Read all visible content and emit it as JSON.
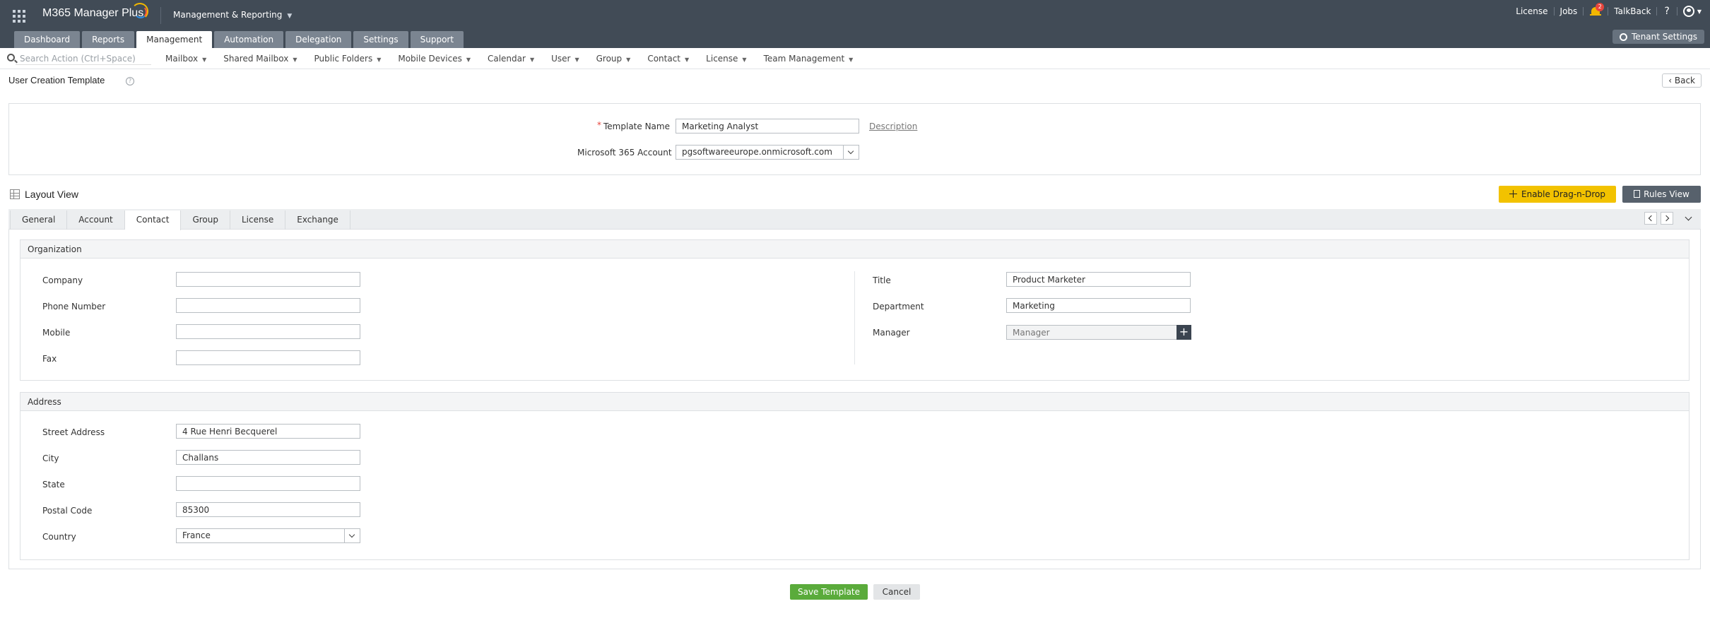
{
  "header": {
    "app_name": "M365 Manager Plus",
    "module": "Management & Reporting",
    "links": [
      "License",
      "Jobs"
    ],
    "notification_count": "2",
    "talkback": "TalkBack",
    "help": "?",
    "tenant_settings": "Tenant Settings"
  },
  "tabs": [
    "Dashboard",
    "Reports",
    "Management",
    "Automation",
    "Delegation",
    "Settings",
    "Support"
  ],
  "active_tab": "Management",
  "subnav": {
    "search_placeholder": "Search Action (Ctrl+Space)",
    "menus": [
      "Mailbox",
      "Shared Mailbox",
      "Public Folders",
      "Mobile Devices",
      "Calendar",
      "User",
      "Group",
      "Contact",
      "License",
      "Team Management"
    ]
  },
  "page": {
    "title": "User Creation Template",
    "back": "Back"
  },
  "template": {
    "name_label": "Template Name",
    "name_value": "Marketing Analyst",
    "description_link": "Description",
    "account_label": "Microsoft 365 Account",
    "account_value": "pgsoftwareeurope.onmicrosoft.com"
  },
  "layout": {
    "title": "Layout View",
    "drag_drop": "Enable Drag-n-Drop",
    "rules_view": "Rules View",
    "tabs": [
      "General",
      "Account",
      "Contact",
      "Group",
      "License",
      "Exchange"
    ],
    "active_tab": "Contact"
  },
  "organization": {
    "title": "Organization",
    "company_label": "Company",
    "company_value": "",
    "phone_label": "Phone Number",
    "phone_value": "",
    "mobile_label": "Mobile",
    "mobile_value": "",
    "fax_label": "Fax",
    "fax_value": "",
    "title_label": "Title",
    "title_value": "Product Marketer",
    "department_label": "Department",
    "department_value": "Marketing",
    "manager_label": "Manager",
    "manager_placeholder": "Manager"
  },
  "address": {
    "title": "Address",
    "street_label": "Street Address",
    "street_value": "4 Rue Henri Becquerel",
    "city_label": "City",
    "city_value": "Challans",
    "state_label": "State",
    "state_value": "",
    "postal_label": "Postal Code",
    "postal_value": "85300",
    "country_label": "Country",
    "country_value": "France"
  },
  "actions": {
    "save": "Save Template",
    "cancel": "Cancel"
  },
  "colors": {
    "header_bg": "#414b56",
    "tab_bg": "#7b8591",
    "drag_drop_btn": "#f2c200",
    "rules_btn": "#57616c",
    "save_btn": "#5aab3b",
    "required": "#e7453c"
  },
  "icons": [
    "apps-grid-icon",
    "logo-arc-icon",
    "chevron-down-icon",
    "bell-icon",
    "user-icon",
    "gear-icon",
    "search-icon",
    "help-icon",
    "back-chevron-icon",
    "layout-grid-icon",
    "move-icon",
    "document-icon",
    "chevron-left-icon",
    "chevron-right-icon",
    "plus-icon"
  ]
}
